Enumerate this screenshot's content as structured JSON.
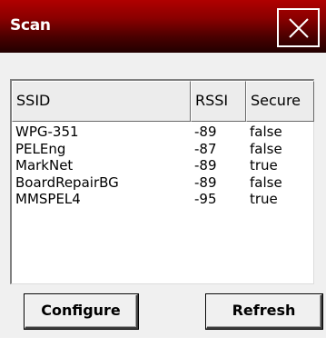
{
  "window": {
    "title": "Scan",
    "close_icon": "close-icon"
  },
  "colors": {
    "titlebar_top": "#b00000",
    "titlebar_bottom": "#220000",
    "client_bg": "#f0f0f0"
  },
  "list": {
    "columns": {
      "ssid": "SSID",
      "rssi": "RSSI",
      "secure": "Secure"
    },
    "rows": [
      {
        "ssid": "WPG-351",
        "rssi": "-89",
        "secure": "false"
      },
      {
        "ssid": "PELEng",
        "rssi": "-87",
        "secure": "false"
      },
      {
        "ssid": "MarkNet",
        "rssi": "-89",
        "secure": "true"
      },
      {
        "ssid": "BoardRepairBG",
        "rssi": "-89",
        "secure": "false"
      },
      {
        "ssid": "MMSPEL4",
        "rssi": "-95",
        "secure": "true"
      }
    ]
  },
  "buttons": {
    "configure": "Configure",
    "refresh": "Refresh"
  }
}
